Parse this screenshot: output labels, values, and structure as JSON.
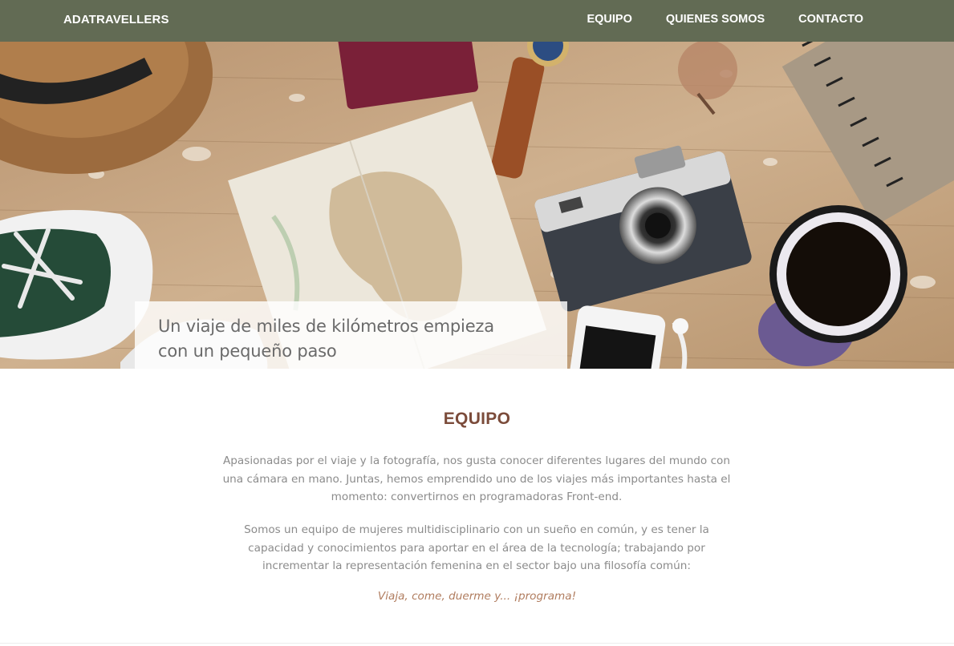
{
  "header": {
    "brand": "ADATRAVELLERS",
    "nav": [
      "EQUIPO",
      "QUIENES SOMOS",
      "CONTACTO"
    ]
  },
  "hero": {
    "quote_line1": "Un viaje de miles de kilómetros empieza",
    "quote_line2": "con un pequeño paso"
  },
  "team": {
    "title": "EQUIPO",
    "paragraph1": "Apasionadas por el viaje y la fotografía, nos gusta conocer diferentes lugares del mundo con una cámara en mano. Juntas, hemos emprendido uno de los viajes más importantes hasta el momento: convertirnos en programadoras Front-end.",
    "paragraph2": "Somos un equipo de mujeres multidisciplinario con un sueño en común, y es tener la capacidad y conocimientos para aportar en el área de la tecnología; trabajando por incrementar la representación femenina en el sector bajo una filosofía común:",
    "motto": "Viaja, come, duerme y... ¡programa!"
  },
  "colors": {
    "nav_bg": "#626b54",
    "title": "#7b4b3a",
    "motto": "#b07c5e"
  }
}
